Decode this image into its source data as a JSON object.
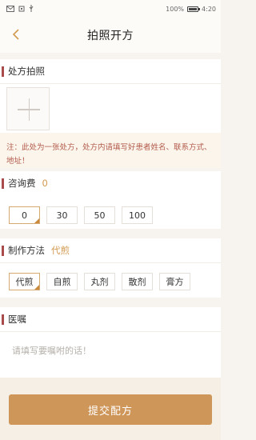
{
  "status_bar": {
    "battery_pct": "100%",
    "time": "4:20"
  },
  "header": {
    "title": "拍照开方"
  },
  "photo_section": {
    "title": "处方拍照"
  },
  "note": {
    "text": "注：此处为一张处方，处方内请填写好患者姓名、联系方式、地址！"
  },
  "fee_section": {
    "title": "咨询费",
    "value": "0",
    "options": [
      "0",
      "30",
      "50",
      "100"
    ],
    "selected": "0"
  },
  "method_section": {
    "title": "制作方法",
    "value": "代煎",
    "options": [
      "代煎",
      "自煎",
      "丸剂",
      "散剂",
      "膏方"
    ],
    "selected": "代煎"
  },
  "advice_section": {
    "title": "医嘱",
    "placeholder": "请填写要嘱咐的话！"
  },
  "submit": {
    "label": "提交配方"
  },
  "colors": {
    "accent": "#cf965a",
    "section_marker": "#a94b4b",
    "note_text": "#b35a4a",
    "selected_value": "#d19a4f"
  }
}
